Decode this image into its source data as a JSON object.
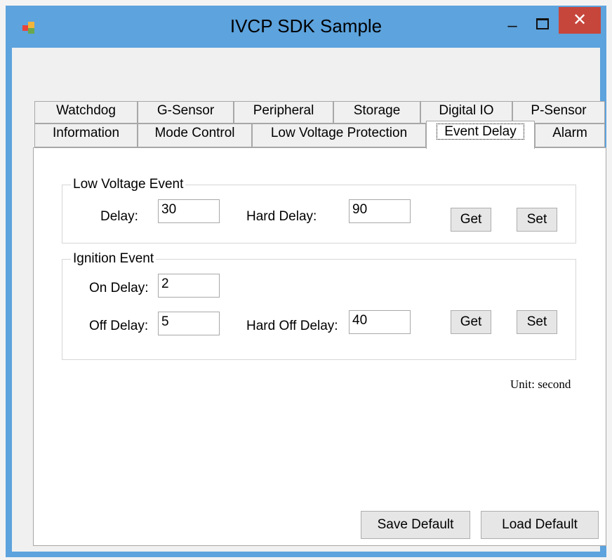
{
  "window": {
    "title": "IVCP SDK Sample",
    "minimize_glyph": "–",
    "close_glyph": "✕"
  },
  "tabs": {
    "row1": [
      "Watchdog",
      "G-Sensor",
      "Peripheral",
      "Storage",
      "Digital IO",
      "P-Sensor"
    ],
    "row2": [
      "Information",
      "Mode Control",
      "Low Voltage Protection",
      "Event Delay",
      "Alarm"
    ],
    "active": "Event Delay"
  },
  "low_voltage_event": {
    "title": "Low Voltage Event",
    "delay_label": "Delay:",
    "delay_value": "30",
    "hard_delay_label": "Hard Delay:",
    "hard_delay_value": "90",
    "get_label": "Get",
    "set_label": "Set"
  },
  "ignition_event": {
    "title": "Ignition Event",
    "on_delay_label": "On Delay:",
    "on_delay_value": "2",
    "off_delay_label": "Off Delay:",
    "off_delay_value": "5",
    "hard_off_delay_label": "Hard Off Delay:",
    "hard_off_delay_value": "40",
    "get_label": "Get",
    "set_label": "Set"
  },
  "unit_text": "Unit: second",
  "footer": {
    "save_default_label": "Save Default",
    "load_default_label": "Load Default"
  },
  "colors": {
    "titlebar": "#5da3dd",
    "close_button": "#c7463c",
    "panel": "#ffffff",
    "client": "#f0f0f0"
  }
}
